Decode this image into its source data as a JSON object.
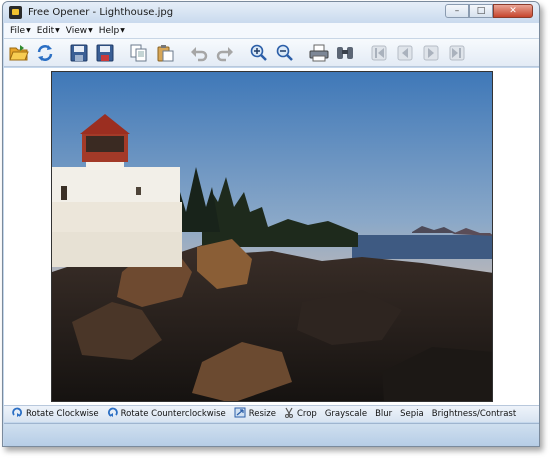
{
  "window": {
    "title": "Free Opener - Lighthouse.jpg",
    "buttons": {
      "minimize": "–",
      "maximize": "□",
      "close": "✕"
    }
  },
  "menu": [
    {
      "label": "File"
    },
    {
      "label": "Edit"
    },
    {
      "label": "View"
    },
    {
      "label": "Help"
    }
  ],
  "toolbar": {
    "icons": [
      "open-folder-icon",
      "refresh-icon",
      "save-icon",
      "save-as-icon",
      "copy-icon",
      "paste-icon",
      "undo-icon",
      "redo-icon",
      "zoom-in-icon",
      "zoom-out-icon",
      "print-icon",
      "find-icon",
      "first-icon",
      "previous-icon",
      "next-icon",
      "last-icon"
    ]
  },
  "image": {
    "name": "Lighthouse.jpg"
  },
  "bottombar": {
    "rotate_cw": "Rotate Clockwise",
    "rotate_ccw": "Rotate Counterclockwise",
    "resize": "Resize",
    "crop": "Crop",
    "grayscale": "Grayscale",
    "blur": "Blur",
    "sepia": "Sepia",
    "brightness": "Brightness/Contrast"
  },
  "colors": {
    "accent": "#c4d7ec",
    "close": "#c6452d"
  }
}
